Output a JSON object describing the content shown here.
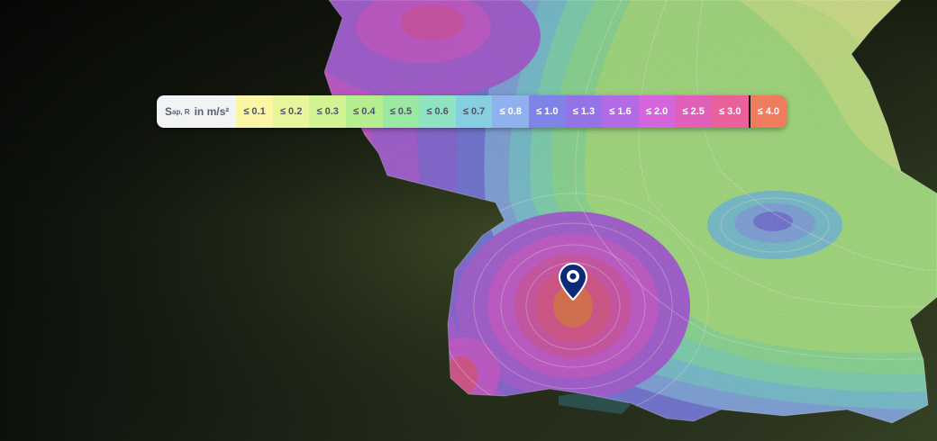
{
  "legend": {
    "title_main": "S",
    "title_sub": "ap, R",
    "title_unit": "in m/s²",
    "items": [
      {
        "label": "≤ 0.1",
        "color": "#fbf6a3",
        "text": "light"
      },
      {
        "label": "≤ 0.2",
        "color": "#e9f59a",
        "text": "light"
      },
      {
        "label": "≤ 0.3",
        "color": "#d2f392",
        "text": "light"
      },
      {
        "label": "≤ 0.4",
        "color": "#b4ee8e",
        "text": "light"
      },
      {
        "label": "≤ 0.5",
        "color": "#9ae9a2",
        "text": "light"
      },
      {
        "label": "≤ 0.6",
        "color": "#8ee3c2",
        "text": "light"
      },
      {
        "label": "≤ 0.7",
        "color": "#86cfe0",
        "text": "light"
      },
      {
        "label": "≤ 0.8",
        "color": "#8fb2ee",
        "text": "dark"
      },
      {
        "label": "≤ 1.0",
        "color": "#7f82e6",
        "text": "dark"
      },
      {
        "label": "≤ 1.3",
        "color": "#9473e6",
        "text": "dark"
      },
      {
        "label": "≤ 1.6",
        "color": "#b36ae4",
        "text": "dark"
      },
      {
        "label": "≤ 2.0",
        "color": "#d465dc",
        "text": "dark"
      },
      {
        "label": "≤ 2.5",
        "color": "#e05fb8",
        "text": "dark"
      },
      {
        "label": "≤ 3.0",
        "color": "#e9609a",
        "text": "dark"
      },
      {
        "label": "≤ 4.0",
        "color": "#ef7c5c",
        "text": "dark"
      }
    ],
    "selected_index": 14
  },
  "marker": {
    "icon": "location-pin-icon",
    "color": "#0b2a7a"
  }
}
